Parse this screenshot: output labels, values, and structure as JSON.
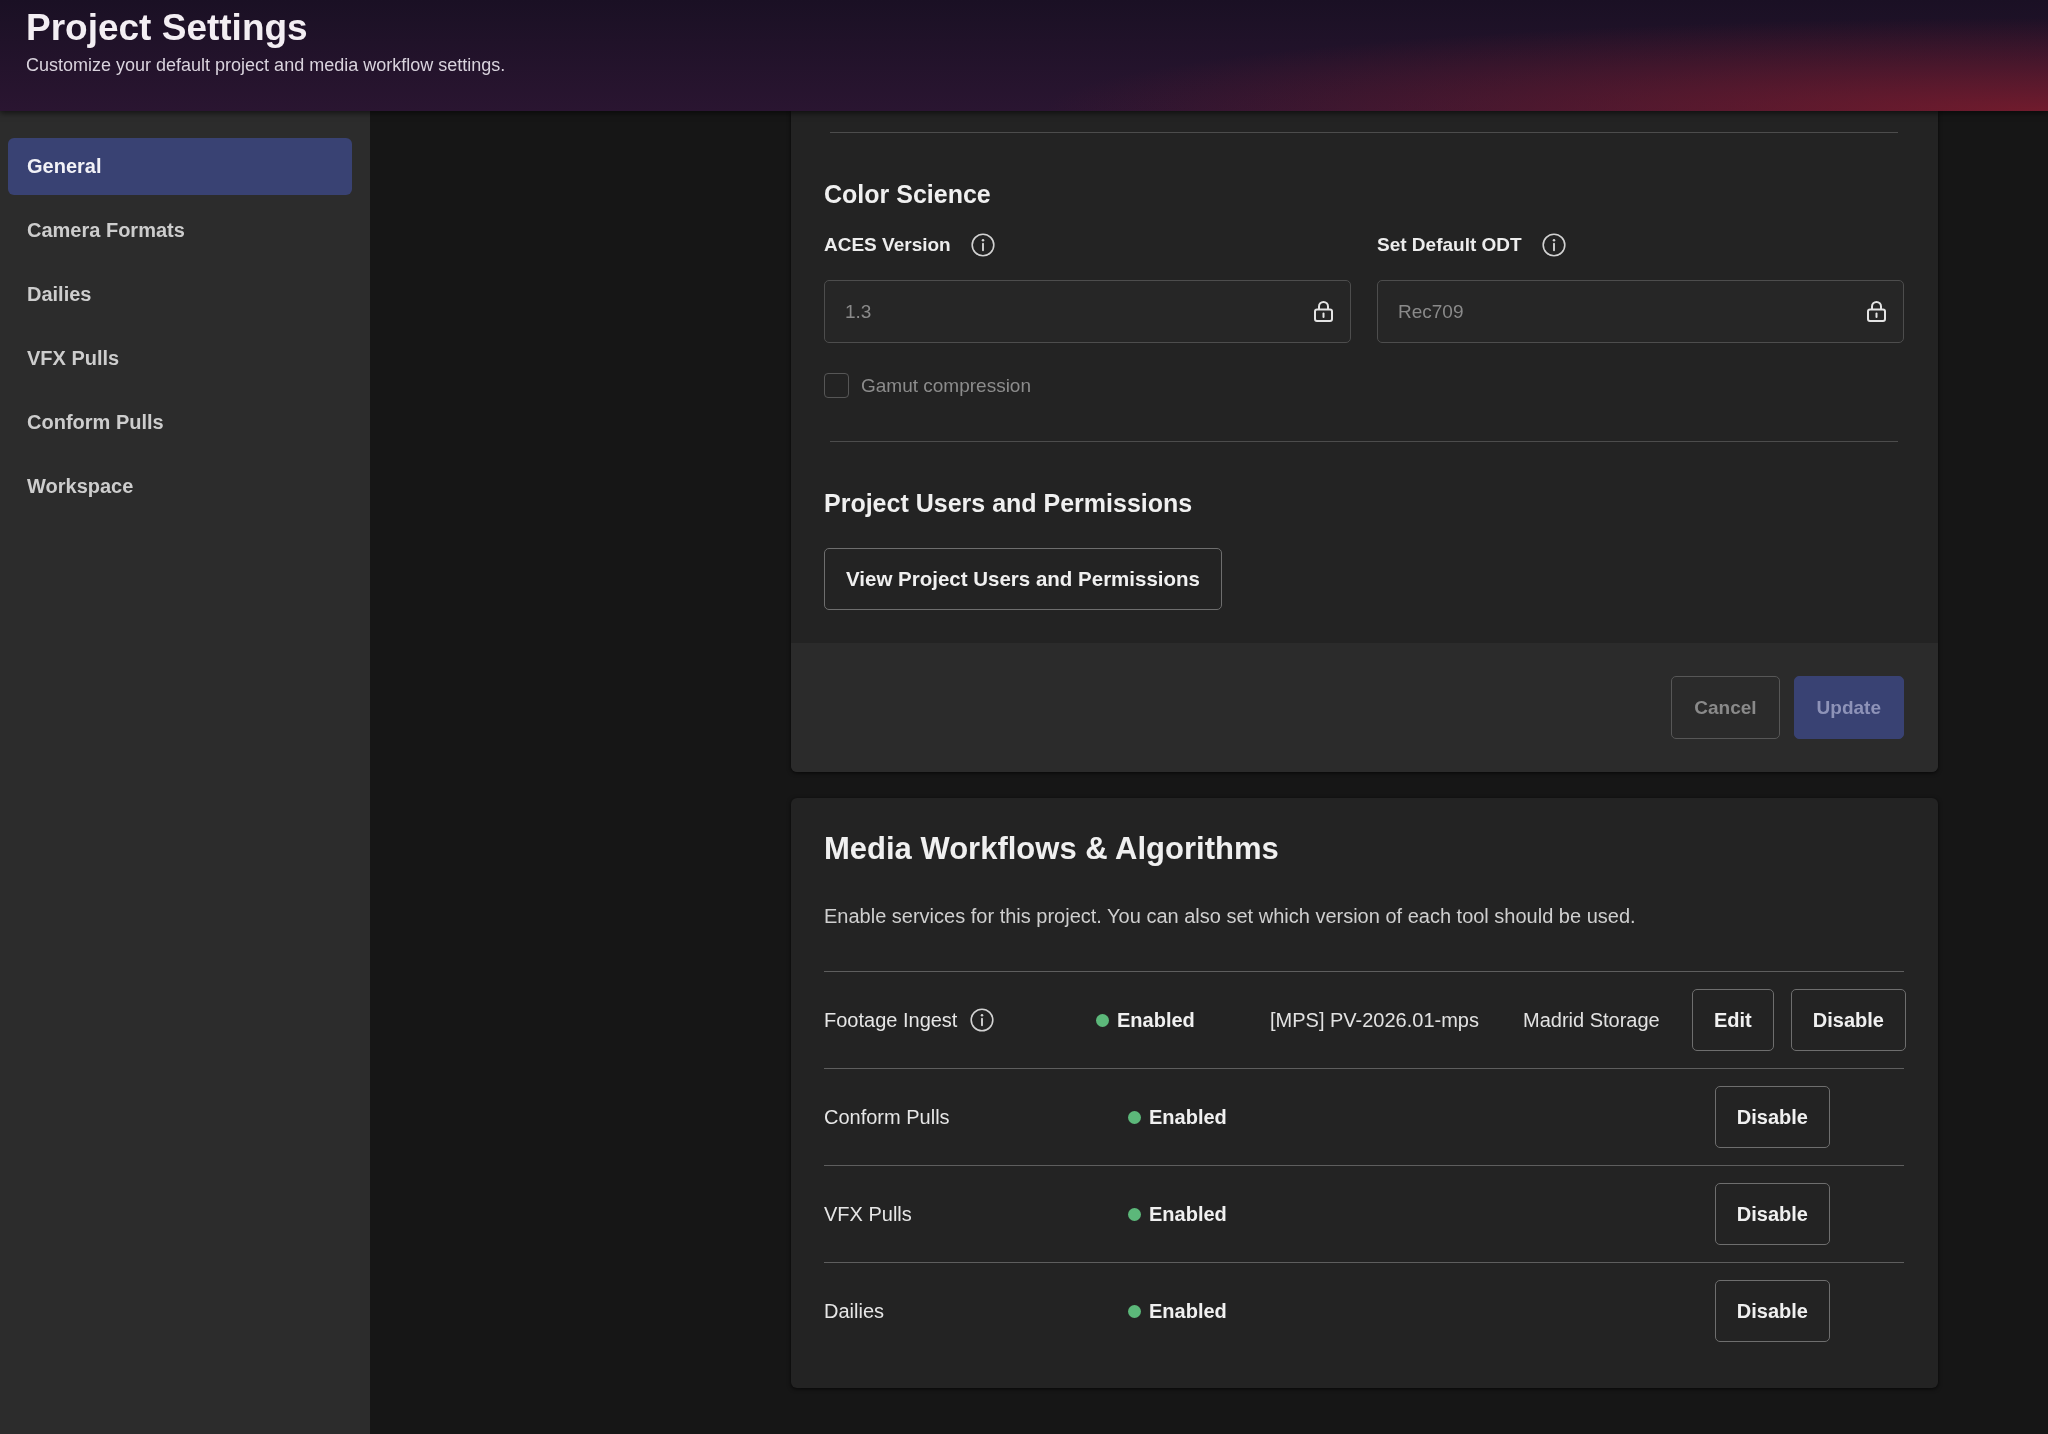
{
  "header": {
    "title": "Project Settings",
    "subtitle": "Customize your default project and media workflow settings."
  },
  "sidebar": {
    "items": [
      {
        "label": "General",
        "selected": true
      },
      {
        "label": "Camera Formats",
        "selected": false
      },
      {
        "label": "Dailies",
        "selected": false
      },
      {
        "label": "VFX Pulls",
        "selected": false
      },
      {
        "label": "Conform Pulls",
        "selected": false
      },
      {
        "label": "Workspace",
        "selected": false
      }
    ]
  },
  "color_science": {
    "title": "Color Science",
    "fields": [
      {
        "label": "ACES Version",
        "info_icon": true,
        "value": "1.3",
        "locked": true
      },
      {
        "label": "Set Default ODT",
        "info_icon": true,
        "value": "Rec709",
        "locked": true
      }
    ],
    "checkbox": {
      "label": "Gamut compression",
      "checked": false,
      "disabled": true
    }
  },
  "users_permissions": {
    "title": "Project Users and Permissions",
    "button": "View Project Users and Permissions"
  },
  "footer_buttons": [
    {
      "label": "Cancel",
      "kind": "secondary",
      "disabled": true
    },
    {
      "label": "Update",
      "kind": "primary",
      "disabled": true
    }
  ],
  "media_workflows": {
    "title": "Media Workflows & Algorithms",
    "description": "Enable services for this project. You can also set which version of each tool should be used.",
    "rows": [
      {
        "kind": "detailed",
        "name": "Footage Ingest",
        "info_icon": true,
        "status": "Enabled",
        "enabled": true,
        "version": "[MPS] PV-2026.01-mps",
        "storage": "Madrid Storage",
        "buttons": [
          "Edit",
          "Disable"
        ]
      },
      {
        "kind": "simple",
        "name": "Conform Pulls",
        "info_icon": false,
        "status": "Enabled",
        "enabled": true,
        "buttons": [
          "Disable"
        ]
      },
      {
        "kind": "simple",
        "name": "VFX Pulls",
        "info_icon": false,
        "status": "Enabled",
        "enabled": true,
        "buttons": [
          "Disable"
        ]
      },
      {
        "kind": "simple",
        "name": "Dailies",
        "info_icon": false,
        "status": "Enabled",
        "enabled": true,
        "buttons": [
          "Disable"
        ]
      }
    ]
  }
}
